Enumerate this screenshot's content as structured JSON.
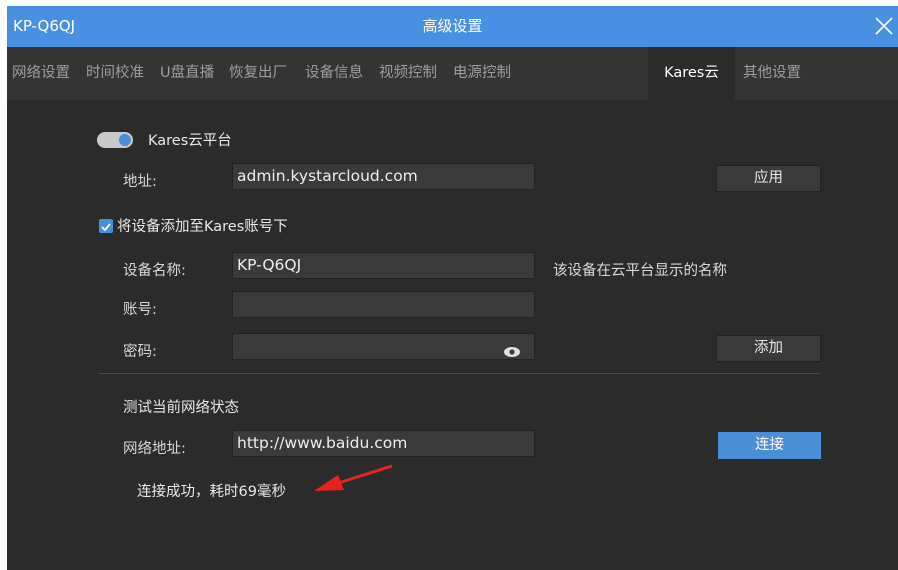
{
  "window": {
    "device_name": "KP-Q6QJ",
    "title": "高级设置",
    "accent_color": "#4a90e2"
  },
  "tabs": [
    {
      "label": "网络设置"
    },
    {
      "label": "时间校准"
    },
    {
      "label": "U盘直播"
    },
    {
      "label": "恢复出厂"
    },
    {
      "label": "设备信息"
    },
    {
      "label": "视频控制"
    },
    {
      "label": "电源控制"
    },
    {
      "label": "Kares云"
    },
    {
      "label": "其他设置"
    }
  ],
  "active_tab": "Kares云",
  "cloud": {
    "toggle_label": "Kares云平台",
    "toggle_on": true,
    "address_label": "地址:",
    "address_value": "admin.kystarcloud.com",
    "apply_label": "应用"
  },
  "bind": {
    "checkbox_label": "将设备添加至Kares账号下",
    "checked": true,
    "device_name_label": "设备名称:",
    "device_name_value": "KP-Q6QJ",
    "device_name_hint": "该设备在云平台显示的名称",
    "account_label": "账号:",
    "account_value": "",
    "password_label": "密码:",
    "password_value": "",
    "add_label": "添加"
  },
  "network_test": {
    "section_title": "测试当前网络状态",
    "url_label": "网络地址:",
    "url_value": "http://www.baidu.com",
    "connect_label": "连接",
    "result": "连接成功，耗时69毫秒"
  }
}
